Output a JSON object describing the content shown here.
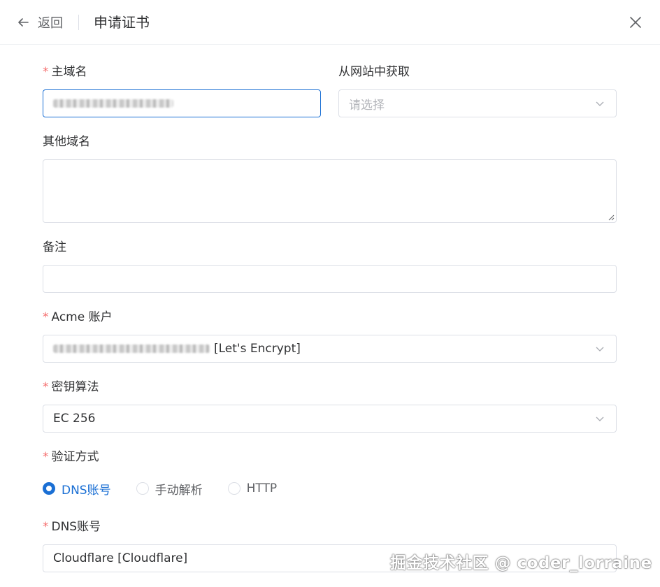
{
  "header": {
    "back_label": "返回",
    "title": "申请证书"
  },
  "form": {
    "main_domain": {
      "label": "主域名",
      "required": "*"
    },
    "from_site": {
      "label": "从网站中获取",
      "placeholder": "请选择"
    },
    "other_domains": {
      "label": "其他域名"
    },
    "remark": {
      "label": "备注"
    },
    "acme_account": {
      "label": "Acme 账户",
      "required": "*",
      "value_suffix": "[Let's Encrypt]"
    },
    "key_algorithm": {
      "label": "密钥算法",
      "required": "*",
      "value": "EC 256"
    },
    "verify_method": {
      "label": "验证方式",
      "required": "*",
      "options": [
        "DNS账号",
        "手动解析",
        "HTTP"
      ],
      "selected": "DNS账号"
    },
    "dns_account": {
      "label": "DNS账号",
      "required": "*",
      "value": "Cloudflare [Cloudflare]"
    }
  },
  "watermark": "掘金技术社区 @ coder_lorraine",
  "colors": {
    "accent": "#1a6fd4",
    "required": "#f56c6c",
    "border": "#dcdfe6"
  }
}
